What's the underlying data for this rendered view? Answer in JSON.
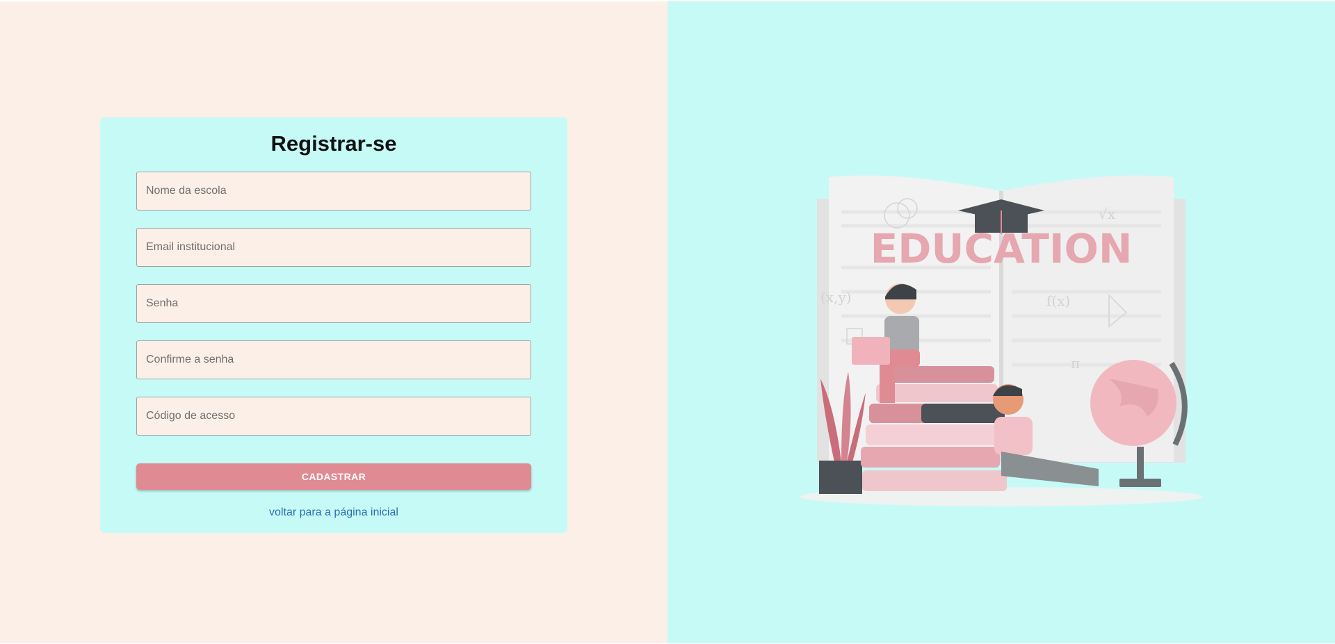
{
  "form": {
    "title": "Registrar-se",
    "fields": [
      {
        "placeholder": "Nome da escola",
        "value": ""
      },
      {
        "placeholder": "Email institucional",
        "value": ""
      },
      {
        "placeholder": "Senha",
        "value": ""
      },
      {
        "placeholder": "Confirme a senha",
        "value": ""
      },
      {
        "placeholder": "Código de acesso",
        "value": ""
      }
    ],
    "submit_label": "CADASTRAR",
    "back_link": "voltar para a página inicial"
  },
  "illustration": {
    "word": "EDUCATION",
    "colors": {
      "left_bg": "#fcefe7",
      "right_bg": "#c6faf7",
      "accent": "#e08a93",
      "link": "#2a6fb0"
    }
  }
}
